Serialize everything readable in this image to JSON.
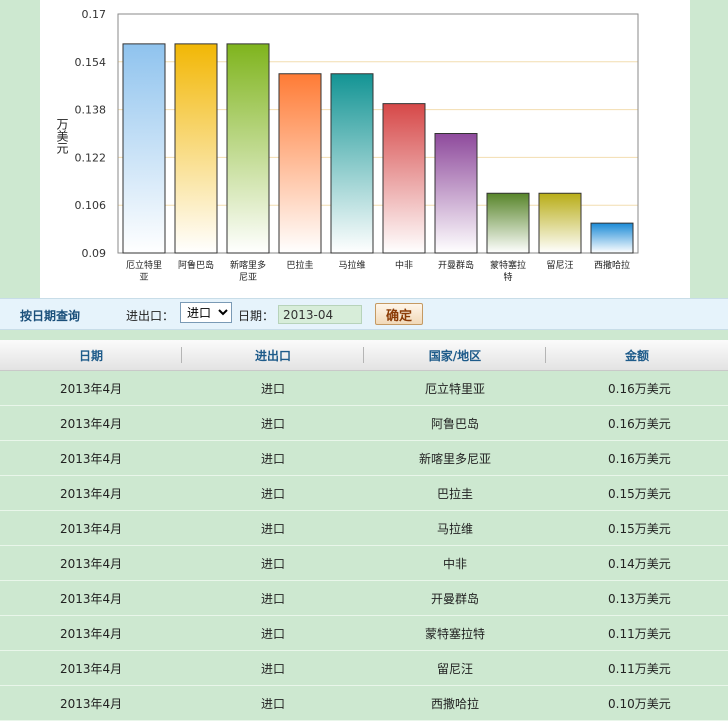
{
  "chart_data": {
    "type": "bar",
    "ylabel": "万美元",
    "ylim": [
      0.09,
      0.17
    ],
    "yticks": [
      "0.17",
      "0.154",
      "0.138",
      "0.122",
      "0.106",
      "0.09"
    ],
    "categories": [
      "厄立特里亚",
      "阿鲁巴岛",
      "新喀里多尼亚",
      "巴拉圭",
      "马拉维",
      "中非",
      "开曼群岛",
      "蒙特塞拉特",
      "留尼汪",
      "西撒哈拉"
    ],
    "category_label_lines": [
      [
        "厄立特里",
        "亚"
      ],
      [
        "阿鲁巴岛"
      ],
      [
        "新喀里多",
        "尼亚"
      ],
      [
        "巴拉圭"
      ],
      [
        "马拉维"
      ],
      [
        "中非"
      ],
      [
        "开曼群岛"
      ],
      [
        "蒙特塞拉",
        "特"
      ],
      [
        "留尼汪"
      ],
      [
        "西撒哈拉"
      ]
    ],
    "values": [
      0.16,
      0.16,
      0.16,
      0.15,
      0.15,
      0.14,
      0.13,
      0.11,
      0.11,
      0.1
    ],
    "bar_colors": [
      "#8fc3ee",
      "#f2b705",
      "#7fb41d",
      "#ff7b35",
      "#139494",
      "#d64848",
      "#8e4a9c",
      "#58852a",
      "#b8ad17",
      "#1a8ad6"
    ],
    "grid": true
  },
  "query": {
    "title": "按日期查询",
    "io_label": "进出口：",
    "io_selected": "进口",
    "date_label": "日期：",
    "date_value": "2013-04",
    "confirm_label": "确定"
  },
  "table": {
    "headers": [
      "日期",
      "进出口",
      "国家/地区",
      "金额"
    ],
    "rows": [
      [
        "2013年4月",
        "进口",
        "厄立特里亚",
        "0.16万美元"
      ],
      [
        "2013年4月",
        "进口",
        "阿鲁巴岛",
        "0.16万美元"
      ],
      [
        "2013年4月",
        "进口",
        "新喀里多尼亚",
        "0.16万美元"
      ],
      [
        "2013年4月",
        "进口",
        "巴拉圭",
        "0.15万美元"
      ],
      [
        "2013年4月",
        "进口",
        "马拉维",
        "0.15万美元"
      ],
      [
        "2013年4月",
        "进口",
        "中非",
        "0.14万美元"
      ],
      [
        "2013年4月",
        "进口",
        "开曼群岛",
        "0.13万美元"
      ],
      [
        "2013年4月",
        "进口",
        "蒙特塞拉特",
        "0.11万美元"
      ],
      [
        "2013年4月",
        "进口",
        "留尼汪",
        "0.11万美元"
      ],
      [
        "2013年4月",
        "进口",
        "西撒哈拉",
        "0.10万美元"
      ]
    ]
  }
}
